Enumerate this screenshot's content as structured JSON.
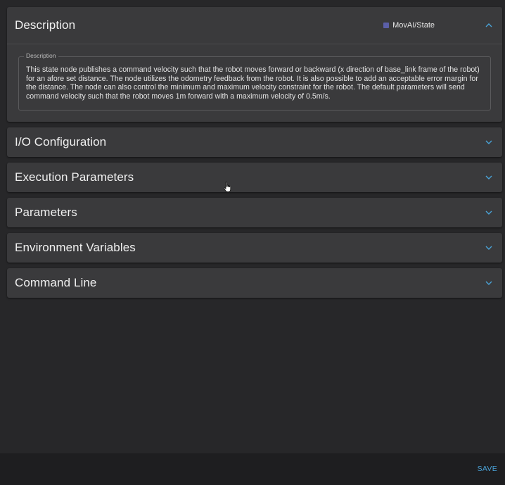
{
  "colors": {
    "accent": "#4aa3d8",
    "badge": "#5b5fa8",
    "panel": "#3a3a3c",
    "background": "#272729",
    "footer": "#1e1e20"
  },
  "description": {
    "title": "Description",
    "badge_label": "MovAI/State",
    "legend": "Description",
    "text": "This state node publishes a command velocity such that the robot moves forward or backward (x direction of base_link frame of the robot) for an afore set distance. The node utilizes the odometry feedback from the robot. It is also possible to add an acceptable error margin for the distance. The node can also control the minimum and maximum velocity constraint for the robot. The default parameters will send command velocity such that the robot moves 1m forward with a maximum velocity of 0.5m/s.",
    "chevron_icon": "chevron-up-icon"
  },
  "panels": [
    {
      "title": "I/O Configuration",
      "chevron_icon": "chevron-down-icon"
    },
    {
      "title": "Execution Parameters",
      "chevron_icon": "chevron-down-icon"
    },
    {
      "title": "Parameters",
      "chevron_icon": "chevron-down-icon"
    },
    {
      "title": "Environment Variables",
      "chevron_icon": "chevron-down-icon"
    },
    {
      "title": "Command Line",
      "chevron_icon": "chevron-down-icon"
    }
  ],
  "footer": {
    "save_label": "SAVE"
  }
}
